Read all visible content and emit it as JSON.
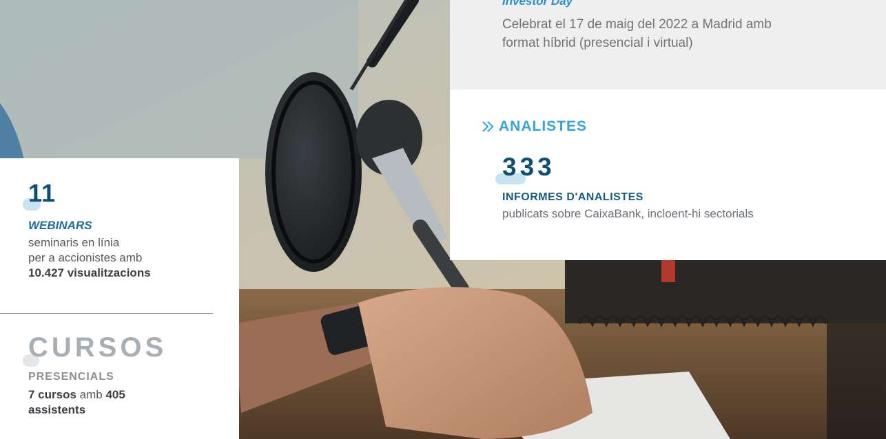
{
  "webinars": {
    "count": "11",
    "label": "WEBINARS",
    "line1": "seminaris en línia",
    "line2": "per a accionistes amb",
    "views": "10.427 visualitzacions"
  },
  "courses": {
    "heading": "CURSOS",
    "subheading": "PRESENCIALS",
    "courses_count": "7 cursos",
    "connector": " amb ",
    "attendees_count": "405",
    "attendees_label": "assistents"
  },
  "investor_day": {
    "title": "Investor Day",
    "line1": "Celebrat el 17 de maig del 2022 a Madrid amb",
    "line2": "format híbrid (presencial i virtual)"
  },
  "analysts": {
    "section_title": "ANALISTES",
    "count": "333",
    "label": "INFORMES D'ANALISTES",
    "description": "publicats sobre CaixaBank, incloent-hi sectorials"
  },
  "colors": {
    "accent_blue": "#34a5dc",
    "dark_blue": "#0f4f73",
    "panel_grey": "#efefef"
  }
}
